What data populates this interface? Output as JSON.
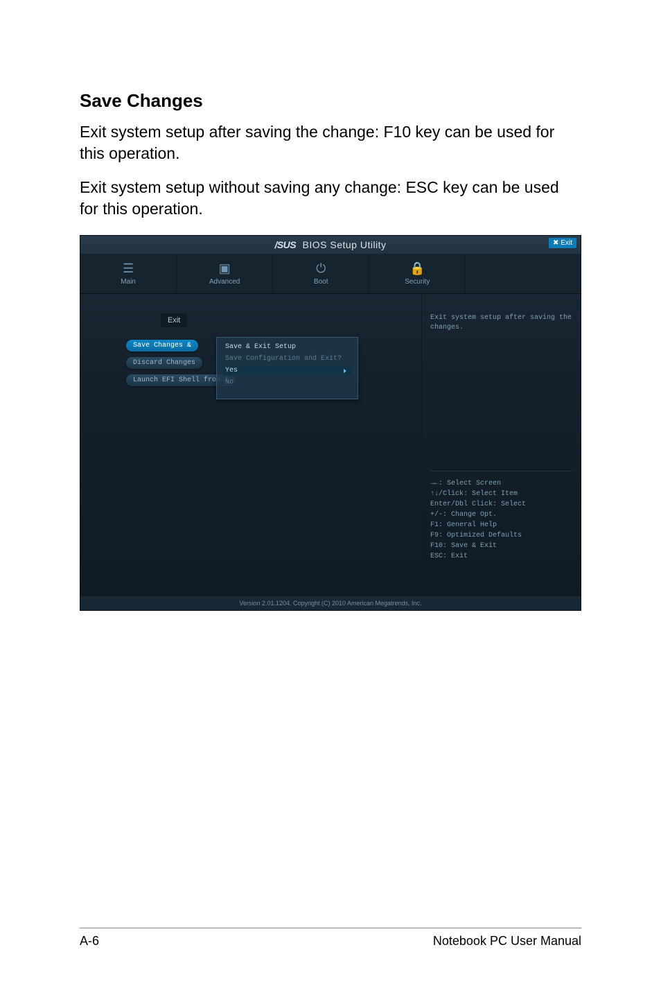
{
  "page": {
    "heading": "Save Changes",
    "para1": "Exit system setup after saving the change: F10 key can be used for this operation.",
    "para2": "Exit system setup without saving any change: ESC key can be used for this operation.",
    "footer_left": "A-6",
    "footer_right": "Notebook PC User Manual"
  },
  "bios": {
    "title_brand": "/SUS",
    "title_rest": "BIOS Setup Utility",
    "exit_btn": "Exit",
    "tabs": {
      "main": "Main",
      "advanced": "Advanced",
      "boot": "Boot",
      "security": "Security"
    },
    "exit_section_label": "Exit",
    "menu": {
      "save_changes": "Save Changes &",
      "discard_changes": "Discard Changes",
      "launch_efi": "Launch EFI Shell from f"
    },
    "submenu": {
      "item1": "Save & Exit Setup",
      "item2": "Save Configuration and Exit?",
      "item3_yes": "Yes",
      "item3_no": "No"
    },
    "help_top": "Exit system setup after saving the changes.",
    "help_bottom": {
      "l1": "→←: Select Screen",
      "l2": "↑↓/Click: Select Item",
      "l3": "Enter/Dbl Click: Select",
      "l4": "+/-: Change Opt.",
      "l5": "F1: General Help",
      "l6": "F9: Optimized Defaults",
      "l7": "F10: Save & Exit",
      "l8": "ESC: Exit"
    },
    "footer": "Version 2.01.1204. Copyright (C) 2010 American Megatrends, Inc."
  }
}
